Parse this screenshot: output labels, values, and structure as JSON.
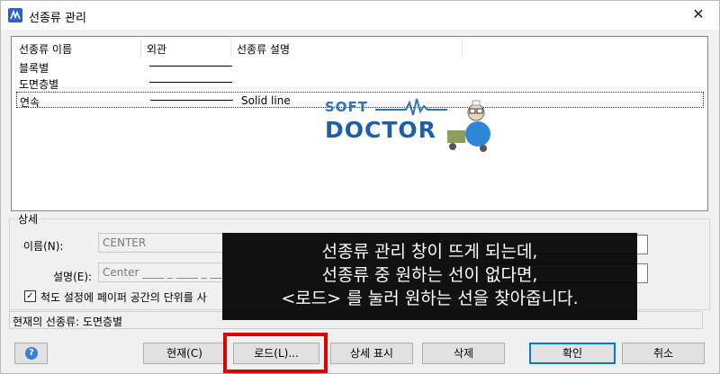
{
  "window": {
    "title": "선종류 관리",
    "close_glyph": "✕"
  },
  "list": {
    "columns": [
      "선종류 이름",
      "외관",
      "선종류 설명"
    ],
    "rows": [
      {
        "name": "블록별",
        "description": ""
      },
      {
        "name": "도면층별",
        "description": ""
      },
      {
        "name": "연속",
        "description": "Solid line"
      }
    ],
    "selected_index": 2
  },
  "watermark": {
    "line1": "SOFT",
    "line2": "DOCTOR"
  },
  "details": {
    "legend": "상세",
    "name_label": "이름(N):",
    "name_value": "CENTER",
    "desc_label": "설명(E):",
    "desc_value": "Center ____ _ ____ _ ____",
    "checkbox_label": "척도 설정에 페이퍼 공간의 단위를 사",
    "checkbox_checked": true,
    "check_glyph": "✓"
  },
  "current": {
    "label": "현재의 선종류: 도면층별"
  },
  "buttons": {
    "help_glyph": "?",
    "current": "현재(C)",
    "load": "로드(L)...",
    "show_details": "상세 표시",
    "delete": "삭제",
    "ok": "확인",
    "cancel": "취소"
  },
  "caption": {
    "lines": [
      "선종류 관리 창이 뜨게 되는데,",
      "선종류 중 원하는 선이 없다면,",
      "<로드> 를 눌러 원하는 선을 찾아줍니다."
    ]
  },
  "colors": {
    "highlight": "#e00000",
    "logo_blue": "#1f5fa8",
    "accent": "#0078d7"
  }
}
